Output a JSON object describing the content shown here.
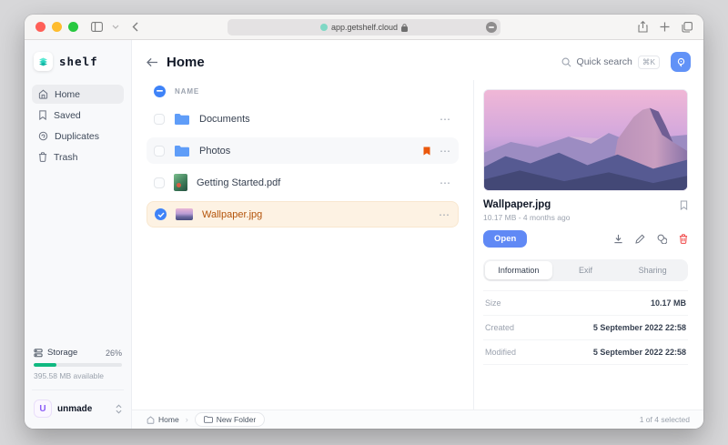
{
  "browser": {
    "url": "app.getshelf.cloud"
  },
  "sidebar": {
    "app_name": "shelf",
    "nav": [
      {
        "label": "Home",
        "active": true
      },
      {
        "label": "Saved",
        "active": false
      },
      {
        "label": "Duplicates",
        "active": false
      },
      {
        "label": "Trash",
        "active": false
      }
    ],
    "storage": {
      "label": "Storage",
      "percent": "26%",
      "available": "395.58 MB available"
    },
    "user": {
      "initial": "U",
      "name": "unmade"
    }
  },
  "header": {
    "title": "Home",
    "search_label": "Quick search",
    "search_shortcut": "⌘K"
  },
  "list": {
    "column_name": "NAME",
    "menu_glyph": "⋯",
    "rows": [
      {
        "name": "Documents",
        "type": "folder",
        "checked": false,
        "bookmarked": false
      },
      {
        "name": "Photos",
        "type": "folder",
        "checked": false,
        "bookmarked": true
      },
      {
        "name": "Getting Started.pdf",
        "type": "pdf",
        "checked": false,
        "bookmarked": false
      },
      {
        "name": "Wallpaper.jpg",
        "type": "image",
        "checked": true,
        "selected": true
      }
    ]
  },
  "details": {
    "filename": "Wallpaper.jpg",
    "meta": "10.17 MB - 4 months ago",
    "open_label": "Open",
    "tabs": [
      {
        "label": "Information",
        "active": true
      },
      {
        "label": "Exif",
        "active": false
      },
      {
        "label": "Sharing",
        "active": false
      }
    ],
    "info": [
      {
        "label": "Size",
        "value": "10.17 MB"
      },
      {
        "label": "Created",
        "value": "5 September 2022 22:58"
      },
      {
        "label": "Modified",
        "value": "5 September 2022 22:58"
      }
    ]
  },
  "statusbar": {
    "home": "Home",
    "chevron": "›",
    "new_folder": "New Folder",
    "selection": "1 of 4 selected"
  },
  "colors": {
    "accent_blue": "#3f83f8",
    "open_button_blue": "#6089f5",
    "selected_row_bg": "#fdf2e3",
    "selected_row_text": "#b4540b",
    "progress_green": "#10b981",
    "folder_blue": "#5f9df8",
    "bookmark_orange": "#ea580c",
    "danger_red": "#ef4444"
  }
}
